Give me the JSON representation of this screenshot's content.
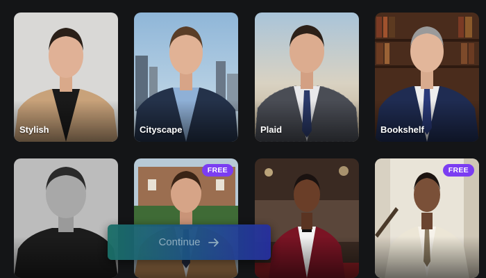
{
  "styles": [
    {
      "label": "Stylish",
      "badge": ""
    },
    {
      "label": "Cityscape",
      "badge": ""
    },
    {
      "label": "Plaid",
      "badge": ""
    },
    {
      "label": "Bookshelf",
      "badge": ""
    },
    {
      "label": "",
      "badge": ""
    },
    {
      "label": "",
      "badge": "FREE"
    },
    {
      "label": "",
      "badge": ""
    },
    {
      "label": "",
      "badge": "FREE"
    }
  ],
  "continue_button": {
    "label": "Continue",
    "icon": "arrow-right-icon"
  },
  "colors": {
    "background": "#141517",
    "badge": "#7b3df2",
    "button_start": "#1b6f67",
    "button_end": "#262f9e"
  }
}
